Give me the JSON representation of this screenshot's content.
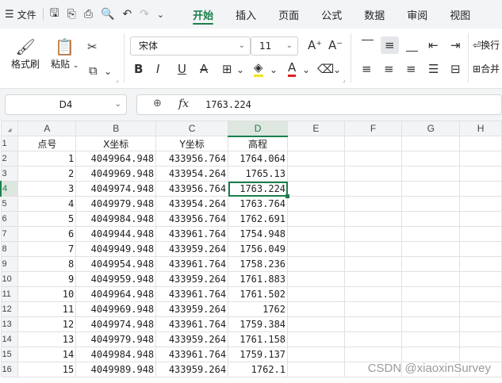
{
  "topbar": {
    "menu_glyph": "☰",
    "menu_label": "文件",
    "tabs": [
      "开始",
      "插入",
      "页面",
      "公式",
      "数据",
      "审阅",
      "视图"
    ],
    "active_tab": "开始"
  },
  "ribbon": {
    "format_painter": "格式刷",
    "paste": "粘贴",
    "font_name": "宋体",
    "font_size": "11",
    "wrap_label": "换行",
    "merge_label": "合并"
  },
  "formula_bar": {
    "name_box": "D4",
    "fx_symbol": "fx",
    "value": "1763.224"
  },
  "sheet": {
    "columns": [
      "A",
      "B",
      "C",
      "D",
      "E",
      "F",
      "G",
      "H"
    ],
    "row_numbers": [
      "1",
      "2",
      "3",
      "4",
      "5",
      "6",
      "7",
      "8",
      "9",
      "10",
      "11",
      "12",
      "13",
      "14",
      "15",
      "16"
    ],
    "header_row": [
      "点号",
      "X坐标",
      "Y坐标",
      "高程"
    ],
    "rows": [
      [
        "1",
        "4049964.948",
        "433956.764",
        "1764.064"
      ],
      [
        "2",
        "4049969.948",
        "433954.264",
        "1765.13"
      ],
      [
        "3",
        "4049974.948",
        "433956.764",
        "1763.224"
      ],
      [
        "4",
        "4049979.948",
        "433954.264",
        "1763.764"
      ],
      [
        "5",
        "4049984.948",
        "433956.764",
        "1762.691"
      ],
      [
        "6",
        "4049944.948",
        "433961.764",
        "1754.948"
      ],
      [
        "7",
        "4049949.948",
        "433959.264",
        "1756.049"
      ],
      [
        "8",
        "4049954.948",
        "433961.764",
        "1758.236"
      ],
      [
        "9",
        "4049959.948",
        "433959.264",
        "1761.883"
      ],
      [
        "10",
        "4049964.948",
        "433961.764",
        "1761.502"
      ],
      [
        "11",
        "4049969.948",
        "433959.264",
        "1762"
      ],
      [
        "12",
        "4049974.948",
        "433961.764",
        "1759.384"
      ],
      [
        "13",
        "4049979.948",
        "433959.264",
        "1761.158"
      ],
      [
        "14",
        "4049984.948",
        "433961.764",
        "1759.137"
      ],
      [
        "15",
        "4049989.948",
        "433959.264",
        "1762.1"
      ]
    ],
    "active_cell": "D4"
  },
  "watermark": "CSDN @xiaoxinSurvey",
  "colors": {
    "accent": "#1a7f4b",
    "toolbar_bg": "#f3f4f6"
  }
}
